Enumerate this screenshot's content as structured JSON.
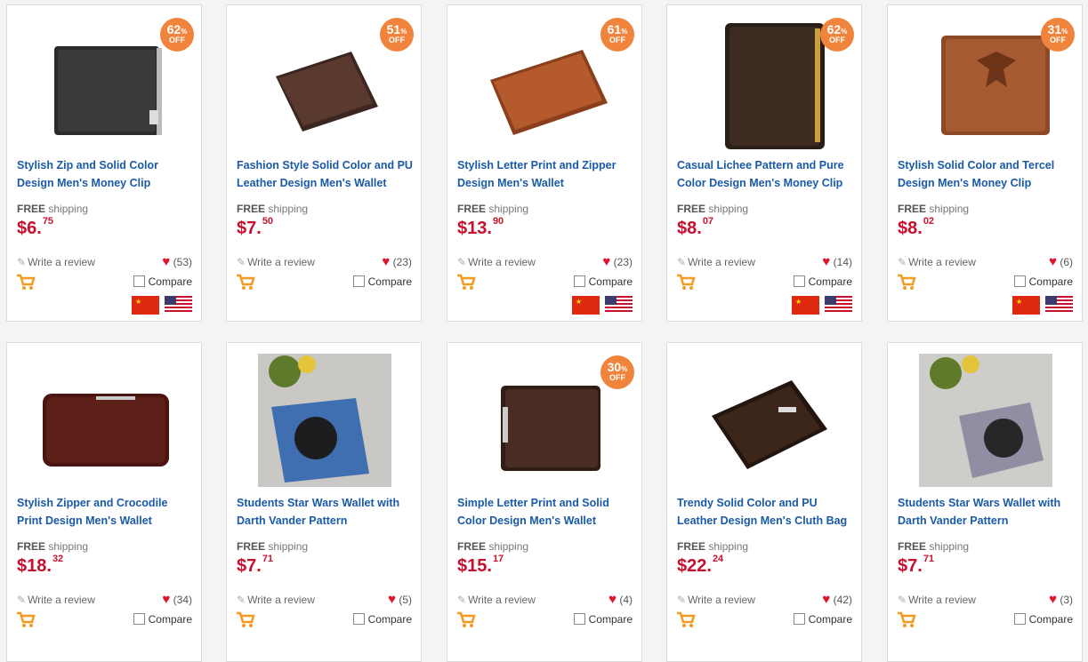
{
  "labels": {
    "free": "FREE",
    "shipping": "shipping",
    "write_review": "Write a review",
    "compare": "Compare",
    "off": "OFF"
  },
  "colors": {
    "title_blue": "#1a5aa6",
    "price_red": "#c8102e",
    "badge_orange": "#f0843c",
    "heart_red": "#e0142b",
    "cart_orange": "#f39a1f"
  },
  "products": [
    {
      "title": "Stylish Zip and Solid Color Design Men's Money Clip",
      "price_main": "$6.",
      "price_cents": "75",
      "likes": "(53)",
      "discount": "62",
      "pct": "%",
      "image": "black-zip-wallet",
      "flags": [
        "china-flag",
        "usa-flag"
      ]
    },
    {
      "title": "Fashion Style Solid Color and PU Leather Design Men's Wallet",
      "price_main": "$7.",
      "price_cents": "50",
      "likes": "(23)",
      "discount": "51",
      "pct": "%",
      "image": "brown-bifold-wallet",
      "flags": []
    },
    {
      "title": "Stylish Letter Print and Zipper Design Men's Wallet",
      "price_main": "$13.",
      "price_cents": "90",
      "likes": "(23)",
      "discount": "61",
      "pct": "%",
      "image": "tan-long-wallet",
      "flags": [
        "china-flag",
        "usa-flag"
      ]
    },
    {
      "title": "Casual Lichee Pattern and Pure Color Design Men's Money Clip",
      "price_main": "$8.",
      "price_cents": "07",
      "likes": "(14)",
      "discount": "62",
      "pct": "%",
      "image": "dark-brown-tall-wallet",
      "flags": [
        "china-flag",
        "usa-flag"
      ]
    },
    {
      "title": "Stylish Solid Color and Tercel Design Men's Money Clip",
      "price_main": "$8.",
      "price_cents": "02",
      "likes": "(6)",
      "discount": "31",
      "pct": "%",
      "image": "eagle-embossed-wallet",
      "flags": [
        "china-flag",
        "usa-flag"
      ]
    },
    {
      "title": "Stylish Zipper and Crocodile Print Design Men's Wallet",
      "price_main": "$18.",
      "price_cents": "32",
      "likes": "(34)",
      "discount": "",
      "pct": "",
      "image": "crocodile-zip-wallet",
      "flags": []
    },
    {
      "title": "Students Star Wars Wallet with Darth Vander Pattern",
      "price_main": "$7.",
      "price_cents": "71",
      "likes": "(5)",
      "discount": "",
      "pct": "",
      "image": "star-wars-wallet-photo",
      "flags": []
    },
    {
      "title": "Simple Letter Print and Solid Color Design Men's Wallet",
      "price_main": "$15.",
      "price_cents": "17",
      "likes": "(4)",
      "discount": "30",
      "pct": "%",
      "image": "brown-zip-bifold-wallet",
      "flags": []
    },
    {
      "title": "Trendy Solid Color and PU Leather Design Men's Cluth Bag",
      "price_main": "$22.",
      "price_cents": "24",
      "likes": "(42)",
      "discount": "",
      "pct": "",
      "image": "leather-clutch-bag",
      "flags": []
    },
    {
      "title": "Students Star Wars Wallet with Darth Vander Pattern",
      "price_main": "$7.",
      "price_cents": "71",
      "likes": "(3)",
      "discount": "",
      "pct": "",
      "image": "star-wars-wallet-photo",
      "flags": []
    }
  ]
}
